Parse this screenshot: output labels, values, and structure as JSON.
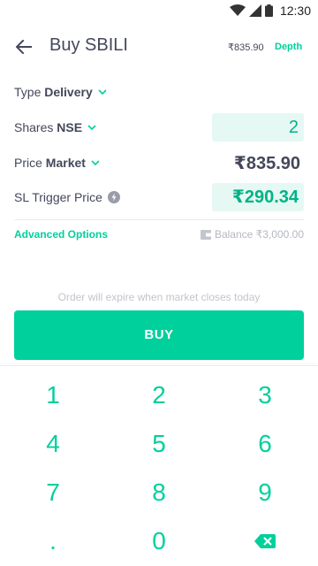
{
  "status_bar": {
    "time": "12:30"
  },
  "header": {
    "title": "Buy SBILI",
    "price": "₹835.90",
    "depth_label": "Depth"
  },
  "form": {
    "type": {
      "label": "Type",
      "value": "Delivery"
    },
    "shares": {
      "label": "Shares",
      "exchange": "NSE",
      "value": "2"
    },
    "price": {
      "label": "Price",
      "value": "Market",
      "amount": "₹835.90"
    },
    "sl_trigger": {
      "label": "SL Trigger Price",
      "value": "₹290.34"
    }
  },
  "advanced_options_label": "Advanced Options",
  "balance_label": "Balance ₹3,000.00",
  "expiry_note": "Order will expire when market closes today",
  "buy_button_label": "BUY",
  "keypad": {
    "keys": [
      "1",
      "2",
      "3",
      "4",
      "5",
      "6",
      "7",
      "8",
      "9",
      ".",
      "0"
    ],
    "backspace_icon": "backspace-icon"
  },
  "colors": {
    "accent": "#00d09c",
    "input_bg": "#e6f8f3",
    "text": "#44475b"
  }
}
